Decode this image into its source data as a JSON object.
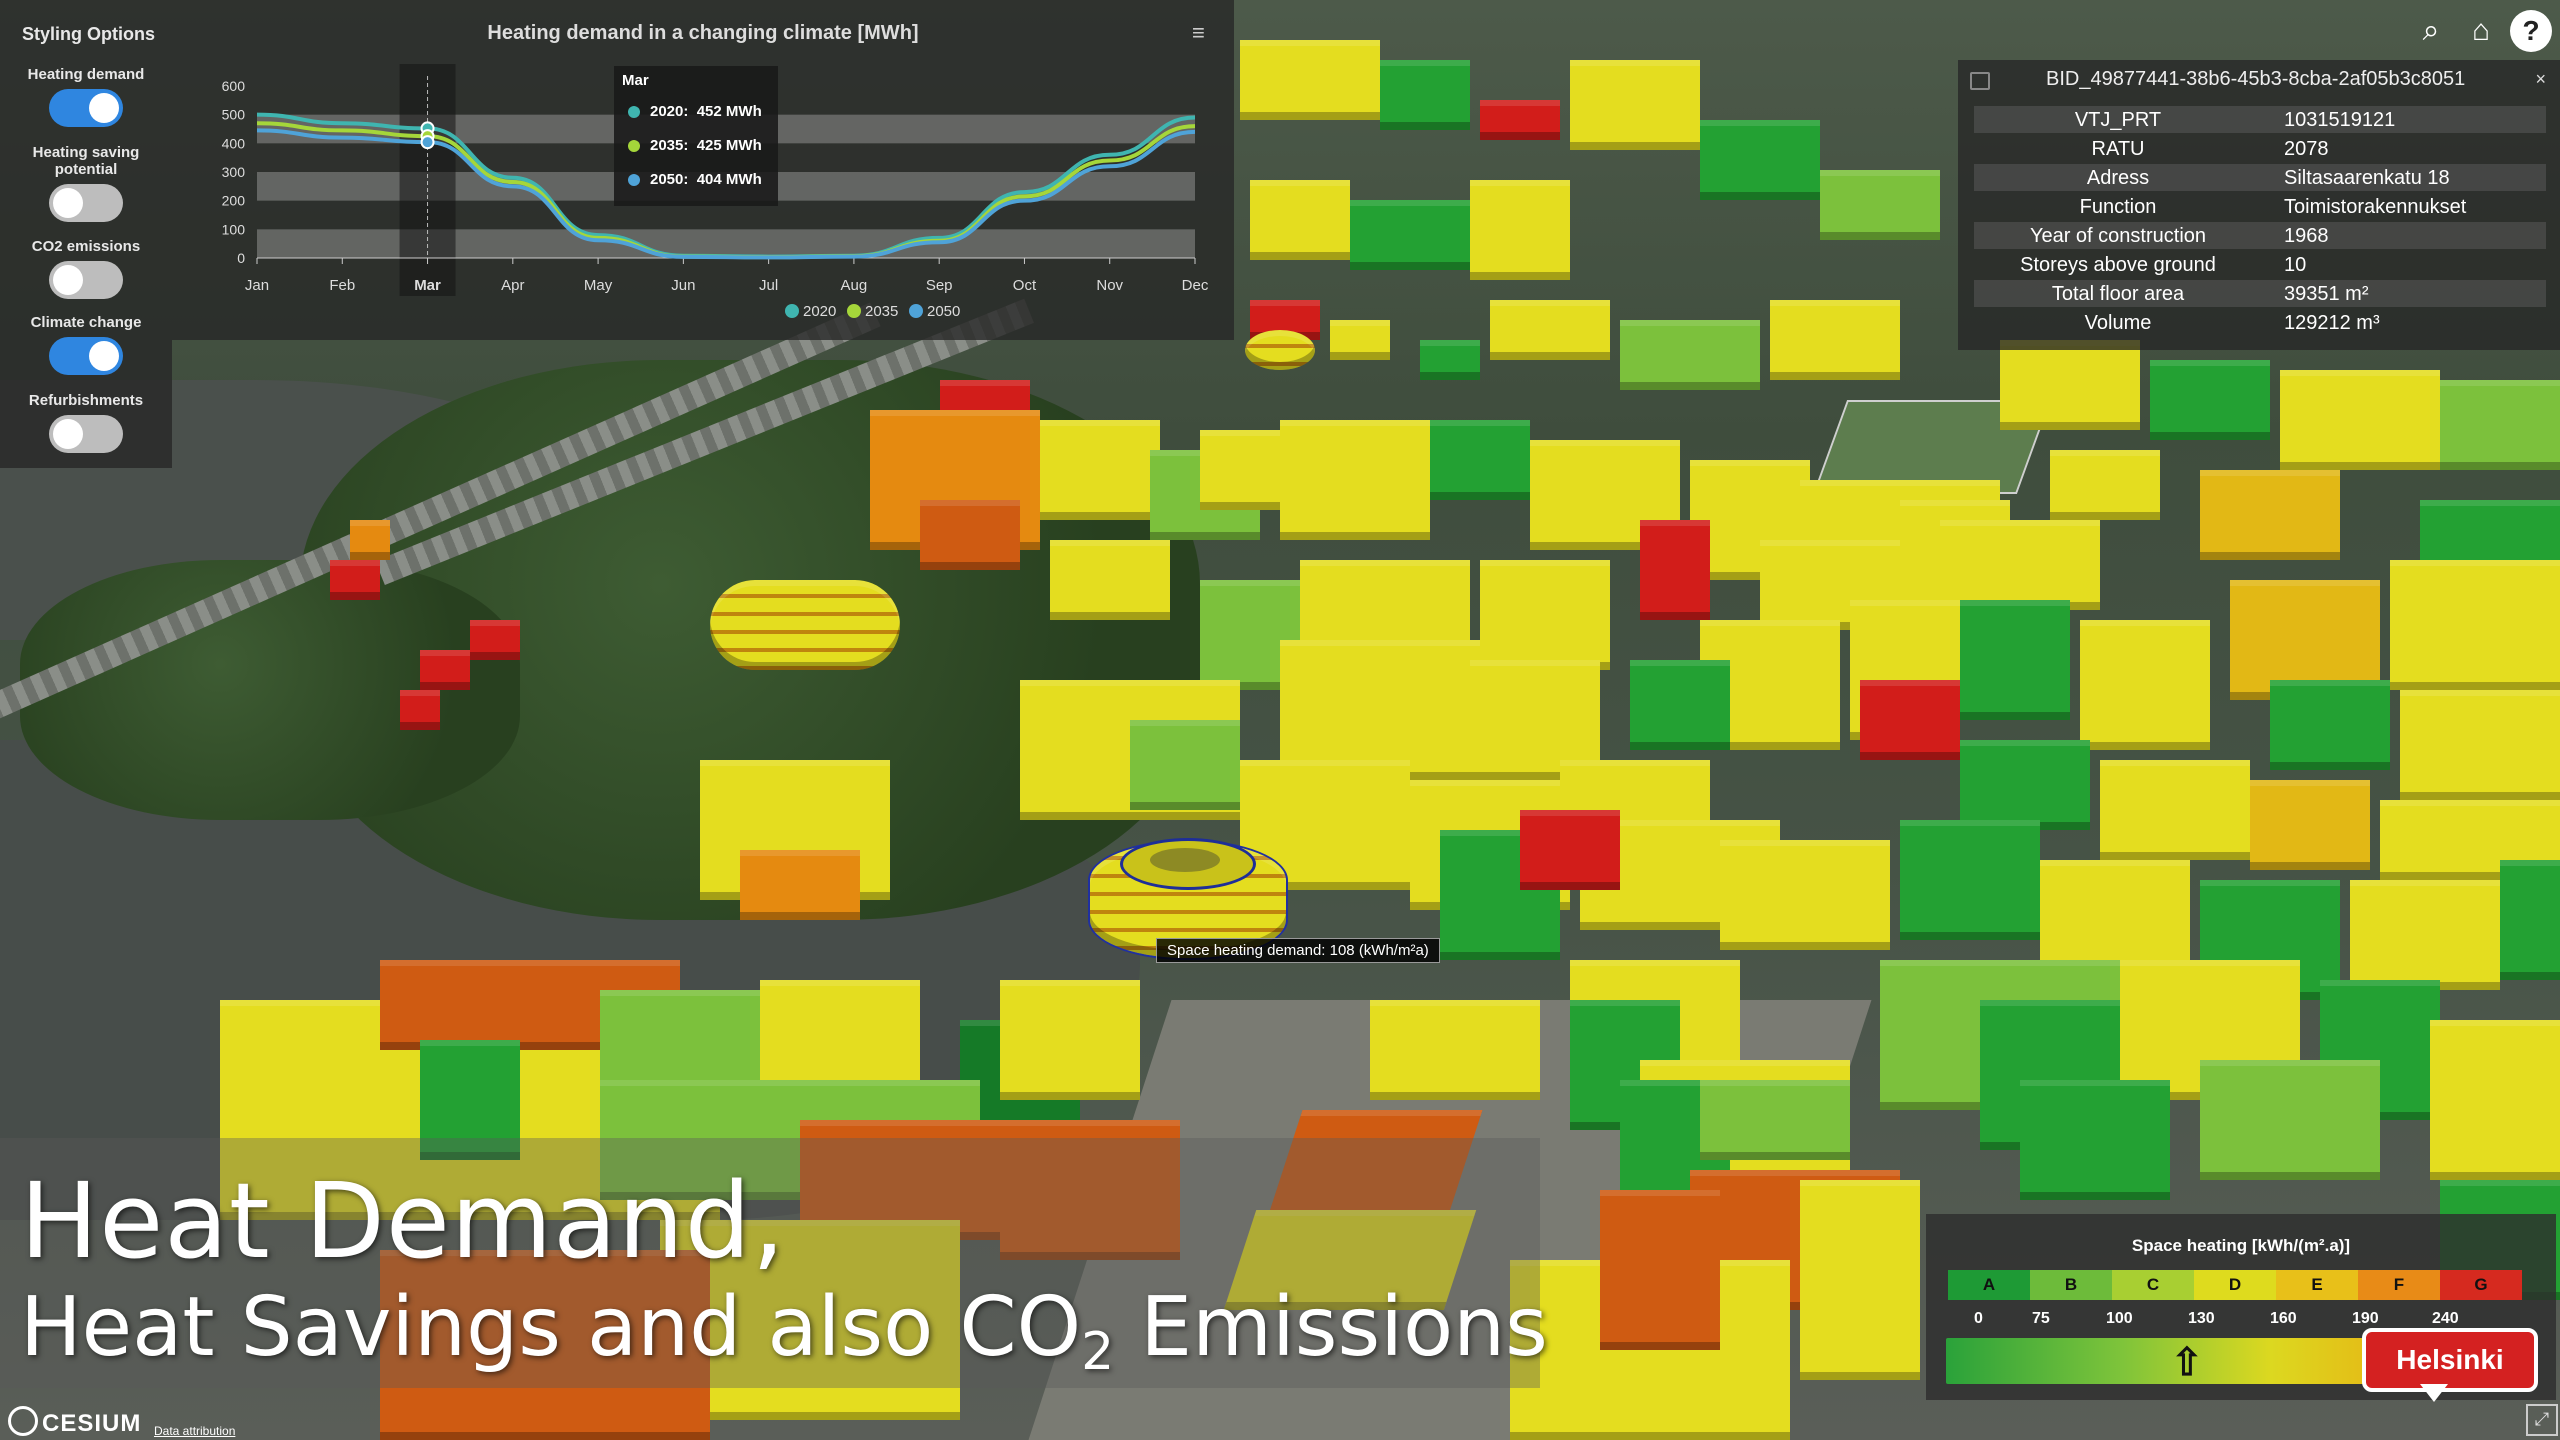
{
  "styling": {
    "title": "Styling Options",
    "options": [
      {
        "label": "Heating demand",
        "on": true
      },
      {
        "label": "Heating saving potential",
        "on": false
      },
      {
        "label": "CO2 emissions",
        "on": false
      },
      {
        "label": "Climate change",
        "on": true
      },
      {
        "label": "Refurbishments",
        "on": false
      }
    ]
  },
  "chart_data": {
    "type": "line",
    "title": "Heating demand in a changing climate [MWh]",
    "categories": [
      "Jan",
      "Feb",
      "Mar",
      "Apr",
      "May",
      "Jun",
      "Jul",
      "Aug",
      "Sep",
      "Oct",
      "Nov",
      "Dec"
    ],
    "yticks": [
      0,
      100,
      200,
      300,
      400,
      500,
      600
    ],
    "ylim": [
      0,
      600
    ],
    "series": [
      {
        "name": "2020",
        "color": "#3fb5b0",
        "values": [
          500,
          470,
          452,
          280,
          80,
          8,
          5,
          8,
          70,
          230,
          360,
          490
        ]
      },
      {
        "name": "2035",
        "color": "#a5d63a",
        "values": [
          470,
          445,
          425,
          265,
          70,
          5,
          3,
          6,
          60,
          215,
          340,
          460
        ]
      },
      {
        "name": "2050",
        "color": "#4fa3d8",
        "values": [
          445,
          420,
          404,
          250,
          62,
          4,
          2,
          5,
          55,
          200,
          320,
          440
        ]
      }
    ],
    "highlight_category": "Mar",
    "tooltip": {
      "title": "Mar",
      "rows": [
        {
          "label": "2020:",
          "value": "452 MWh"
        },
        {
          "label": "2035:",
          "value": "425 MWh"
        },
        {
          "label": "2050:",
          "value": "404 MWh"
        }
      ]
    },
    "legend": "bottom"
  },
  "info": {
    "id": "BID_49877441-38b6-45b3-8cba-2af05b3c8051",
    "close": "×",
    "rows": [
      {
        "k": "VTJ_PRT",
        "v": "1031519121"
      },
      {
        "k": "RATU",
        "v": "2078"
      },
      {
        "k": "Adress",
        "v": "Siltasaarenkatu 18"
      },
      {
        "k": "Function",
        "v": "Toimistorakennukset"
      },
      {
        "k": "Year of construction",
        "v": "1968"
      },
      {
        "k": "Storeys above ground",
        "v": "10"
      },
      {
        "k": "Total floor area",
        "v": "39351 m²"
      },
      {
        "k": "Volume",
        "v": "129212 m³"
      }
    ]
  },
  "tools": {
    "search_icon": "⌕",
    "home_icon": "⌂",
    "help_icon": "?"
  },
  "legend": {
    "title": "Space heating [kWh/(m².a)]",
    "classes": [
      {
        "label": "A",
        "color": "#1e9a35"
      },
      {
        "label": "B",
        "color": "#6dbb3a"
      },
      {
        "label": "C",
        "color": "#a8cf32"
      },
      {
        "label": "D",
        "color": "#dedb1e"
      },
      {
        "label": "E",
        "color": "#e8c019"
      },
      {
        "label": "F",
        "color": "#e88b17"
      },
      {
        "label": "G",
        "color": "#d62a1f"
      }
    ],
    "ticks": [
      "0",
      "75",
      "100",
      "130",
      "160",
      "190",
      "240"
    ],
    "arrow": "⇧"
  },
  "badge": "Helsinki",
  "heading": {
    "line1": "Heat Demand,",
    "line2_a": "Heat Savings and also CO",
    "line2_sub": "2",
    "line2_b": " Emissions"
  },
  "building_label": "Space heating demand: 108 (kWh/m²a)",
  "footer": {
    "brand": "CESIUM",
    "attribution": "Data attribution"
  },
  "fullscreen_icon": "⤢"
}
